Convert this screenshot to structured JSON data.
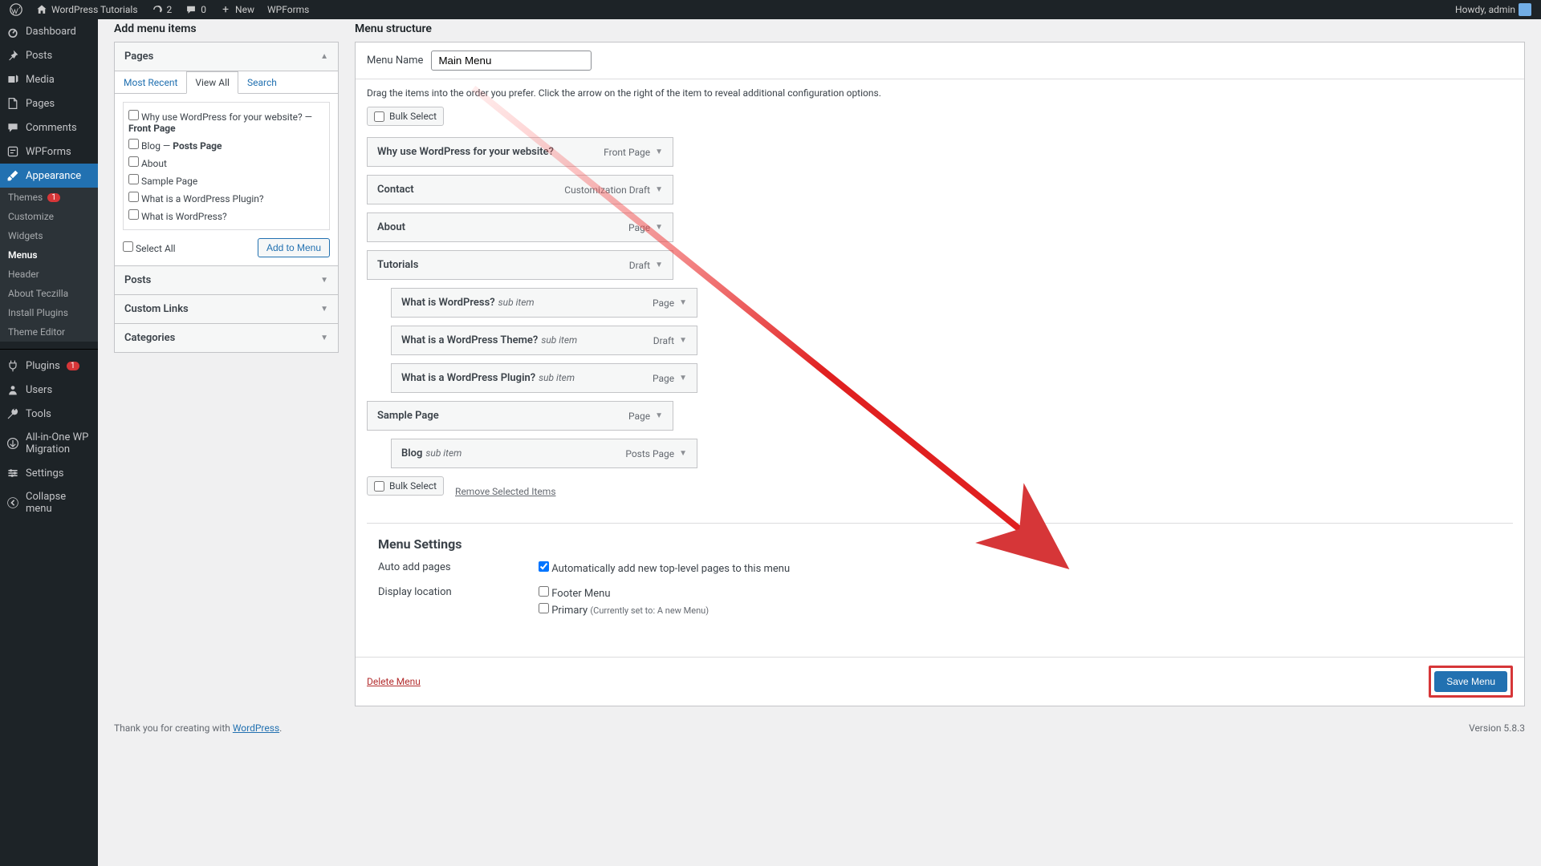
{
  "adminbar": {
    "site_title": "WordPress Tutorials",
    "comment_count": "0",
    "update_count": "2",
    "new_label": "New",
    "wpforms_label": "WPForms",
    "howdy": "Howdy, admin"
  },
  "sidebar": {
    "items": [
      {
        "icon": "dashboard",
        "label": "Dashboard"
      },
      {
        "icon": "pin",
        "label": "Posts"
      },
      {
        "icon": "media",
        "label": "Media"
      },
      {
        "icon": "page",
        "label": "Pages"
      },
      {
        "icon": "comment",
        "label": "Comments"
      },
      {
        "icon": "form",
        "label": "WPForms"
      },
      {
        "icon": "brush",
        "label": "Appearance",
        "current": true
      }
    ],
    "appearance_sub": [
      {
        "label": "Themes",
        "badge": "1"
      },
      {
        "label": "Customize"
      },
      {
        "label": "Widgets"
      },
      {
        "label": "Menus",
        "current": true
      },
      {
        "label": "Header"
      },
      {
        "label": "About Teczilla"
      },
      {
        "label": "Install Plugins"
      },
      {
        "label": "Theme Editor"
      }
    ],
    "items2": [
      {
        "icon": "plug",
        "label": "Plugins",
        "badge": "1"
      },
      {
        "icon": "user",
        "label": "Users"
      },
      {
        "icon": "wrench",
        "label": "Tools"
      },
      {
        "icon": "migrate",
        "label": "All-in-One WP Migration"
      },
      {
        "icon": "settings",
        "label": "Settings"
      },
      {
        "icon": "collapse",
        "label": "Collapse menu"
      }
    ]
  },
  "add_column": {
    "title": "Add menu items",
    "accordions": {
      "pages": {
        "title": "Pages",
        "tabs": {
          "recent": "Most Recent",
          "view_all": "View All",
          "search": "Search"
        },
        "pages": [
          "Why use WordPress for your website? — Front Page",
          "Blog — Posts Page",
          "About",
          "Sample Page",
          "What is a WordPress Plugin?",
          "What is WordPress?"
        ],
        "select_all": "Select All",
        "add_btn": "Add to Menu"
      },
      "posts": "Posts",
      "custom": "Custom Links",
      "categories": "Categories"
    }
  },
  "structure": {
    "title": "Menu structure",
    "name_label": "Menu Name",
    "name_value": "Main Menu",
    "hint": "Drag the items into the order you prefer. Click the arrow on the right of the item to reveal additional configuration options.",
    "bulk_label": "Bulk Select",
    "remove_label": "Remove Selected Items",
    "items": [
      {
        "title": "Why use WordPress for your website?",
        "type": "Front Page",
        "depth": 0
      },
      {
        "title": "Contact",
        "type": "Customization Draft",
        "depth": 0
      },
      {
        "title": "About",
        "type": "Page",
        "depth": 0
      },
      {
        "title": "Tutorials",
        "type": "Draft",
        "depth": 0
      },
      {
        "title": "What is WordPress?",
        "sub": "sub item",
        "type": "Page",
        "depth": 1
      },
      {
        "title": "What is a WordPress Theme?",
        "sub": "sub item",
        "type": "Draft",
        "depth": 1
      },
      {
        "title": "What is a WordPress Plugin?",
        "sub": "sub item",
        "type": "Page",
        "depth": 1
      },
      {
        "title": "Sample Page",
        "type": "Page",
        "depth": 0
      },
      {
        "title": "Blog",
        "sub": "sub item",
        "type": "Posts Page",
        "depth": 1
      }
    ]
  },
  "settings": {
    "title": "Menu Settings",
    "auto_label": "Auto add pages",
    "auto_opt": "Automatically add new top-level pages to this menu",
    "loc_label": "Display location",
    "loc_footer": "Footer Menu",
    "loc_primary": "Primary",
    "loc_primary_note": "(Currently set to: A new Menu)"
  },
  "footer_actions": {
    "delete": "Delete Menu",
    "save": "Save Menu"
  },
  "footer": {
    "thanks": "Thank you for creating with ",
    "wp": "WordPress",
    "version": "Version 5.8.3"
  }
}
